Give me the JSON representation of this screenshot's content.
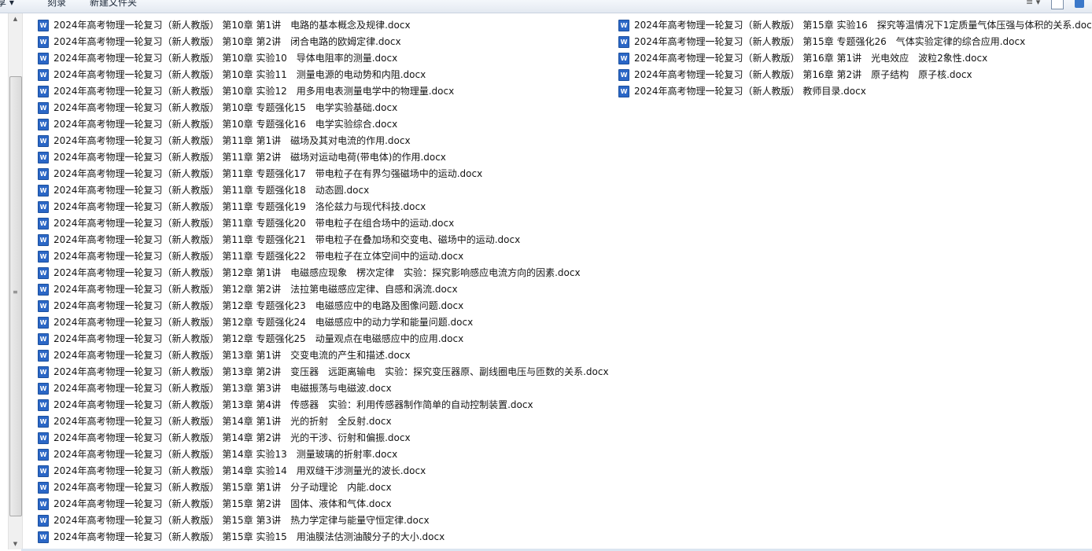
{
  "toolbar": {
    "share_label": "享 ▾",
    "burn_label": "刻录",
    "new_folder_label": "新建文件夹",
    "view_options_label": "≡ ▾"
  },
  "icons": {
    "word_icon_letter": "W",
    "scroll_up_glyph": "▲",
    "scroll_down_glyph": "▼",
    "scroll_grip_glyph": "≡"
  },
  "colors": {
    "word_icon": "#2b67c6",
    "toolbar_bg": "#e3e9f1"
  },
  "files": {
    "col1": [
      "2024年高考物理一轮复习（新人教版） 第10章 第1讲　电路的基本概念及规律.docx",
      "2024年高考物理一轮复习（新人教版） 第10章 第2讲　闭合电路的欧姆定律.docx",
      "2024年高考物理一轮复习（新人教版） 第10章 实验10　导体电阻率的测量.docx",
      "2024年高考物理一轮复习（新人教版） 第10章 实验11　测量电源的电动势和内阻.docx",
      "2024年高考物理一轮复习（新人教版） 第10章 实验12　用多用电表测量电学中的物理量.docx",
      "2024年高考物理一轮复习（新人教版） 第10章 专题强化15　电学实验基础.docx",
      "2024年高考物理一轮复习（新人教版） 第10章 专题强化16　电学实验综合.docx",
      "2024年高考物理一轮复习（新人教版） 第11章 第1讲　磁场及其对电流的作用.docx",
      "2024年高考物理一轮复习（新人教版） 第11章 第2讲　磁场对运动电荷(带电体)的作用.docx",
      "2024年高考物理一轮复习（新人教版） 第11章 专题强化17　带电粒子在有界匀强磁场中的运动.docx",
      "2024年高考物理一轮复习（新人教版） 第11章 专题强化18　动态圆.docx",
      "2024年高考物理一轮复习（新人教版） 第11章 专题强化19　洛伦兹力与现代科技.docx",
      "2024年高考物理一轮复习（新人教版） 第11章 专题强化20　带电粒子在组合场中的运动.docx",
      "2024年高考物理一轮复习（新人教版） 第11章 专题强化21　带电粒子在叠加场和交变电、磁场中的运动.docx",
      "2024年高考物理一轮复习（新人教版） 第11章 专题强化22　带电粒子在立体空间中的运动.docx",
      "2024年高考物理一轮复习（新人教版） 第12章 第1讲　电磁感应现象　楞次定律　实验：探究影响感应电流方向的因素.docx",
      "2024年高考物理一轮复习（新人教版） 第12章 第2讲　法拉第电磁感应定律、自感和涡流.docx",
      "2024年高考物理一轮复习（新人教版） 第12章 专题强化23　电磁感应中的电路及图像问题.docx",
      "2024年高考物理一轮复习（新人教版） 第12章 专题强化24　电磁感应中的动力学和能量问题.docx",
      "2024年高考物理一轮复习（新人教版） 第12章 专题强化25　动量观点在电磁感应中的应用.docx",
      "2024年高考物理一轮复习（新人教版） 第13章 第1讲　交变电流的产生和描述.docx",
      "2024年高考物理一轮复习（新人教版） 第13章 第2讲　变压器　远距离输电　实验：探究变压器原、副线圈电压与匝数的关系.docx",
      "2024年高考物理一轮复习（新人教版） 第13章 第3讲　电磁振荡与电磁波.docx",
      "2024年高考物理一轮复习（新人教版） 第13章 第4讲　传感器　实验：利用传感器制作简单的自动控制装置.docx",
      "2024年高考物理一轮复习（新人教版） 第14章 第1讲　光的折射　全反射.docx",
      "2024年高考物理一轮复习（新人教版） 第14章 第2讲　光的干涉、衍射和偏振.docx",
      "2024年高考物理一轮复习（新人教版） 第14章 实验13　测量玻璃的折射率.docx",
      "2024年高考物理一轮复习（新人教版） 第14章 实验14　用双缝干涉测量光的波长.docx",
      "2024年高考物理一轮复习（新人教版） 第15章 第1讲　分子动理论　内能.docx",
      "2024年高考物理一轮复习（新人教版） 第15章 第2讲　固体、液体和气体.docx",
      "2024年高考物理一轮复习（新人教版） 第15章 第3讲　热力学定律与能量守恒定律.docx",
      "2024年高考物理一轮复习（新人教版） 第15章 实验15　用油膜法估测油酸分子的大小.docx"
    ],
    "col2": [
      "2024年高考物理一轮复习（新人教版） 第15章 实验16　探究等温情况下1定质量气体压强与体积的关系.docx",
      "2024年高考物理一轮复习（新人教版） 第15章 专题强化26　气体实验定律的综合应用.docx",
      "2024年高考物理一轮复习（新人教版） 第16章 第1讲　光电效应　波粒2象性.docx",
      "2024年高考物理一轮复习（新人教版） 第16章 第2讲　原子结构　原子核.docx",
      "2024年高考物理一轮复习（新人教版） 教师目录.docx"
    ]
  }
}
